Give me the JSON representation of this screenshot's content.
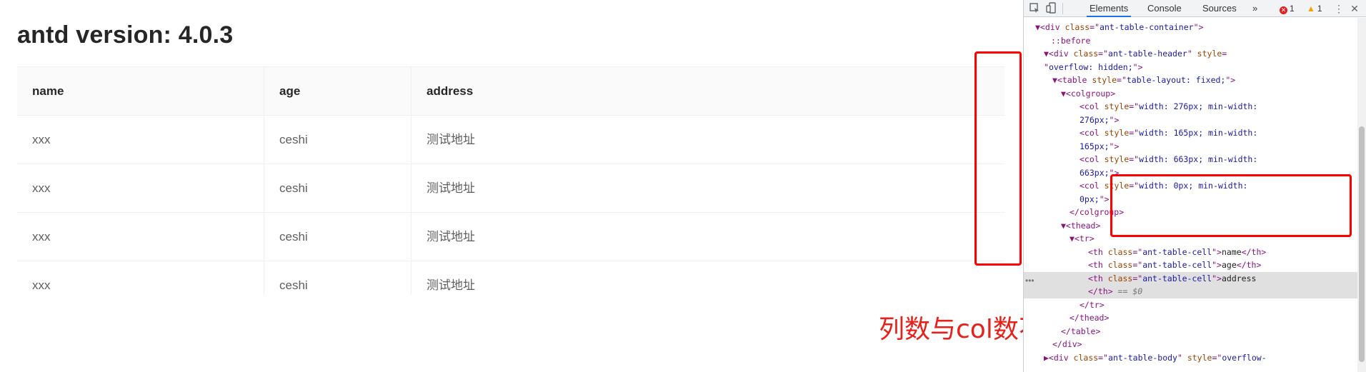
{
  "page": {
    "title": "antd version: 4.0.3",
    "table": {
      "columns": [
        "name",
        "age",
        "address"
      ],
      "rows": [
        [
          "xxx",
          "ceshi",
          "测试地址"
        ],
        [
          "xxx",
          "ceshi",
          "测试地址"
        ],
        [
          "xxx",
          "ceshi",
          "测试地址"
        ],
        [
          "xxx",
          "ceshi",
          "测试地址"
        ]
      ]
    },
    "annotation": "列数与col数不一致"
  },
  "devtools": {
    "tabs": [
      "Elements",
      "Console",
      "Sources"
    ],
    "more_tabs": "»",
    "errors": "1",
    "warnings": "1",
    "menu": "⋮",
    "close": "✕",
    "lines": [
      {
        "parts": [
          [
            "tag",
            "▼<div "
          ],
          [
            "attr",
            "class"
          ],
          [
            "tag",
            "=\""
          ],
          [
            "val",
            "ant-table-container"
          ],
          [
            "tag",
            "\">"
          ]
        ],
        "indent": 116
      },
      {
        "parts": [
          [
            "pseudo",
            "::before"
          ]
        ],
        "indent": 138
      },
      {
        "parts": [
          [
            "tag",
            "▼<div "
          ],
          [
            "attr",
            "class"
          ],
          [
            "tag",
            "=\""
          ],
          [
            "val",
            "ant-table-header"
          ],
          [
            "tag",
            "\" "
          ],
          [
            "attr",
            "style"
          ],
          [
            "tag",
            "="
          ]
        ],
        "indent": 128
      },
      {
        "parts": [
          [
            "tag",
            "\""
          ],
          [
            "val",
            "overflow: hidden;"
          ],
          [
            "tag",
            "\">"
          ]
        ],
        "indent": 128
      },
      {
        "parts": [
          [
            "tag",
            "▼<table "
          ],
          [
            "attr",
            "style"
          ],
          [
            "tag",
            "=\""
          ],
          [
            "val",
            "table-layout: fixed;"
          ],
          [
            "tag",
            "\">"
          ]
        ],
        "indent": 140
      },
      {
        "parts": [
          [
            "tag",
            "▼<colgroup>"
          ]
        ],
        "indent": 152
      },
      {
        "parts": [
          [
            "tag",
            "<col "
          ],
          [
            "attr",
            "style"
          ],
          [
            "tag",
            "=\""
          ],
          [
            "val",
            "width: 276px; min-width:"
          ]
        ],
        "indent": 178
      },
      {
        "parts": [
          [
            "val",
            "276px;"
          ],
          [
            "tag",
            "\">"
          ]
        ],
        "indent": 178
      },
      {
        "parts": [
          [
            "tag",
            "<col "
          ],
          [
            "attr",
            "style"
          ],
          [
            "tag",
            "=\""
          ],
          [
            "val",
            "width: 165px; min-width:"
          ]
        ],
        "indent": 178
      },
      {
        "parts": [
          [
            "val",
            "165px;"
          ],
          [
            "tag",
            "\">"
          ]
        ],
        "indent": 178
      },
      {
        "parts": [
          [
            "tag",
            "<col "
          ],
          [
            "attr",
            "style"
          ],
          [
            "tag",
            "=\""
          ],
          [
            "val",
            "width: 663px; min-width:"
          ]
        ],
        "indent": 178
      },
      {
        "parts": [
          [
            "val",
            "663px;"
          ],
          [
            "tag",
            "\">"
          ]
        ],
        "indent": 178
      },
      {
        "parts": [
          [
            "tag",
            "<col "
          ],
          [
            "attr",
            "style"
          ],
          [
            "tag",
            "=\""
          ],
          [
            "val",
            "width: 0px; min-width:"
          ]
        ],
        "indent": 178
      },
      {
        "parts": [
          [
            "val",
            "0px;"
          ],
          [
            "tag",
            "\">"
          ]
        ],
        "indent": 178
      },
      {
        "parts": [
          [
            "tag",
            "</colgroup>"
          ]
        ],
        "indent": 164
      },
      {
        "parts": [
          [
            "tag",
            "▼<thead>"
          ]
        ],
        "indent": 152
      },
      {
        "parts": [
          [
            "tag",
            "▼<tr>"
          ]
        ],
        "indent": 164
      },
      {
        "parts": [
          [
            "tag",
            "<th "
          ],
          [
            "attr",
            "class"
          ],
          [
            "tag",
            "=\""
          ],
          [
            "val",
            "ant-table-cell"
          ],
          [
            "tag",
            "\">"
          ],
          [
            "txt",
            "name"
          ],
          [
            "tag",
            "</th>"
          ]
        ],
        "indent": 190
      },
      {
        "parts": [
          [
            "tag",
            "<th "
          ],
          [
            "attr",
            "class"
          ],
          [
            "tag",
            "=\""
          ],
          [
            "val",
            "ant-table-cell"
          ],
          [
            "tag",
            "\">"
          ],
          [
            "txt",
            "age"
          ],
          [
            "tag",
            "</th>"
          ]
        ],
        "indent": 190
      },
      {
        "parts": [
          [
            "tag",
            "<th "
          ],
          [
            "attr",
            "class"
          ],
          [
            "tag",
            "=\""
          ],
          [
            "val",
            "ant-table-cell"
          ],
          [
            "tag",
            "\">"
          ],
          [
            "txt",
            "address"
          ]
        ],
        "indent": 190,
        "highlight": true
      },
      {
        "parts": [
          [
            "tag",
            "</th>"
          ],
          [
            "sel0",
            " == $0"
          ]
        ],
        "indent": 190,
        "highlight": true
      },
      {
        "parts": [
          [
            "tag",
            "</tr>"
          ]
        ],
        "indent": 178
      },
      {
        "parts": [
          [
            "tag",
            "</thead>"
          ]
        ],
        "indent": 164
      },
      {
        "parts": [
          [
            "tag",
            "</table>"
          ]
        ],
        "indent": 152
      },
      {
        "parts": [
          [
            "tag",
            "</div>"
          ]
        ],
        "indent": 140
      },
      {
        "parts": [
          [
            "tag",
            "▶<div "
          ],
          [
            "attr",
            "class"
          ],
          [
            "tag",
            "=\""
          ],
          [
            "val",
            "ant-table-body"
          ],
          [
            "tag",
            "\" "
          ],
          [
            "attr",
            "style"
          ],
          [
            "tag",
            "=\""
          ],
          [
            "val",
            "overflow-"
          ]
        ],
        "indent": 128
      }
    ],
    "colors": {
      "accent": "#1a73e8",
      "error": "#e41e1e",
      "warning": "#f5a300",
      "annotation": "#e8201a"
    }
  }
}
